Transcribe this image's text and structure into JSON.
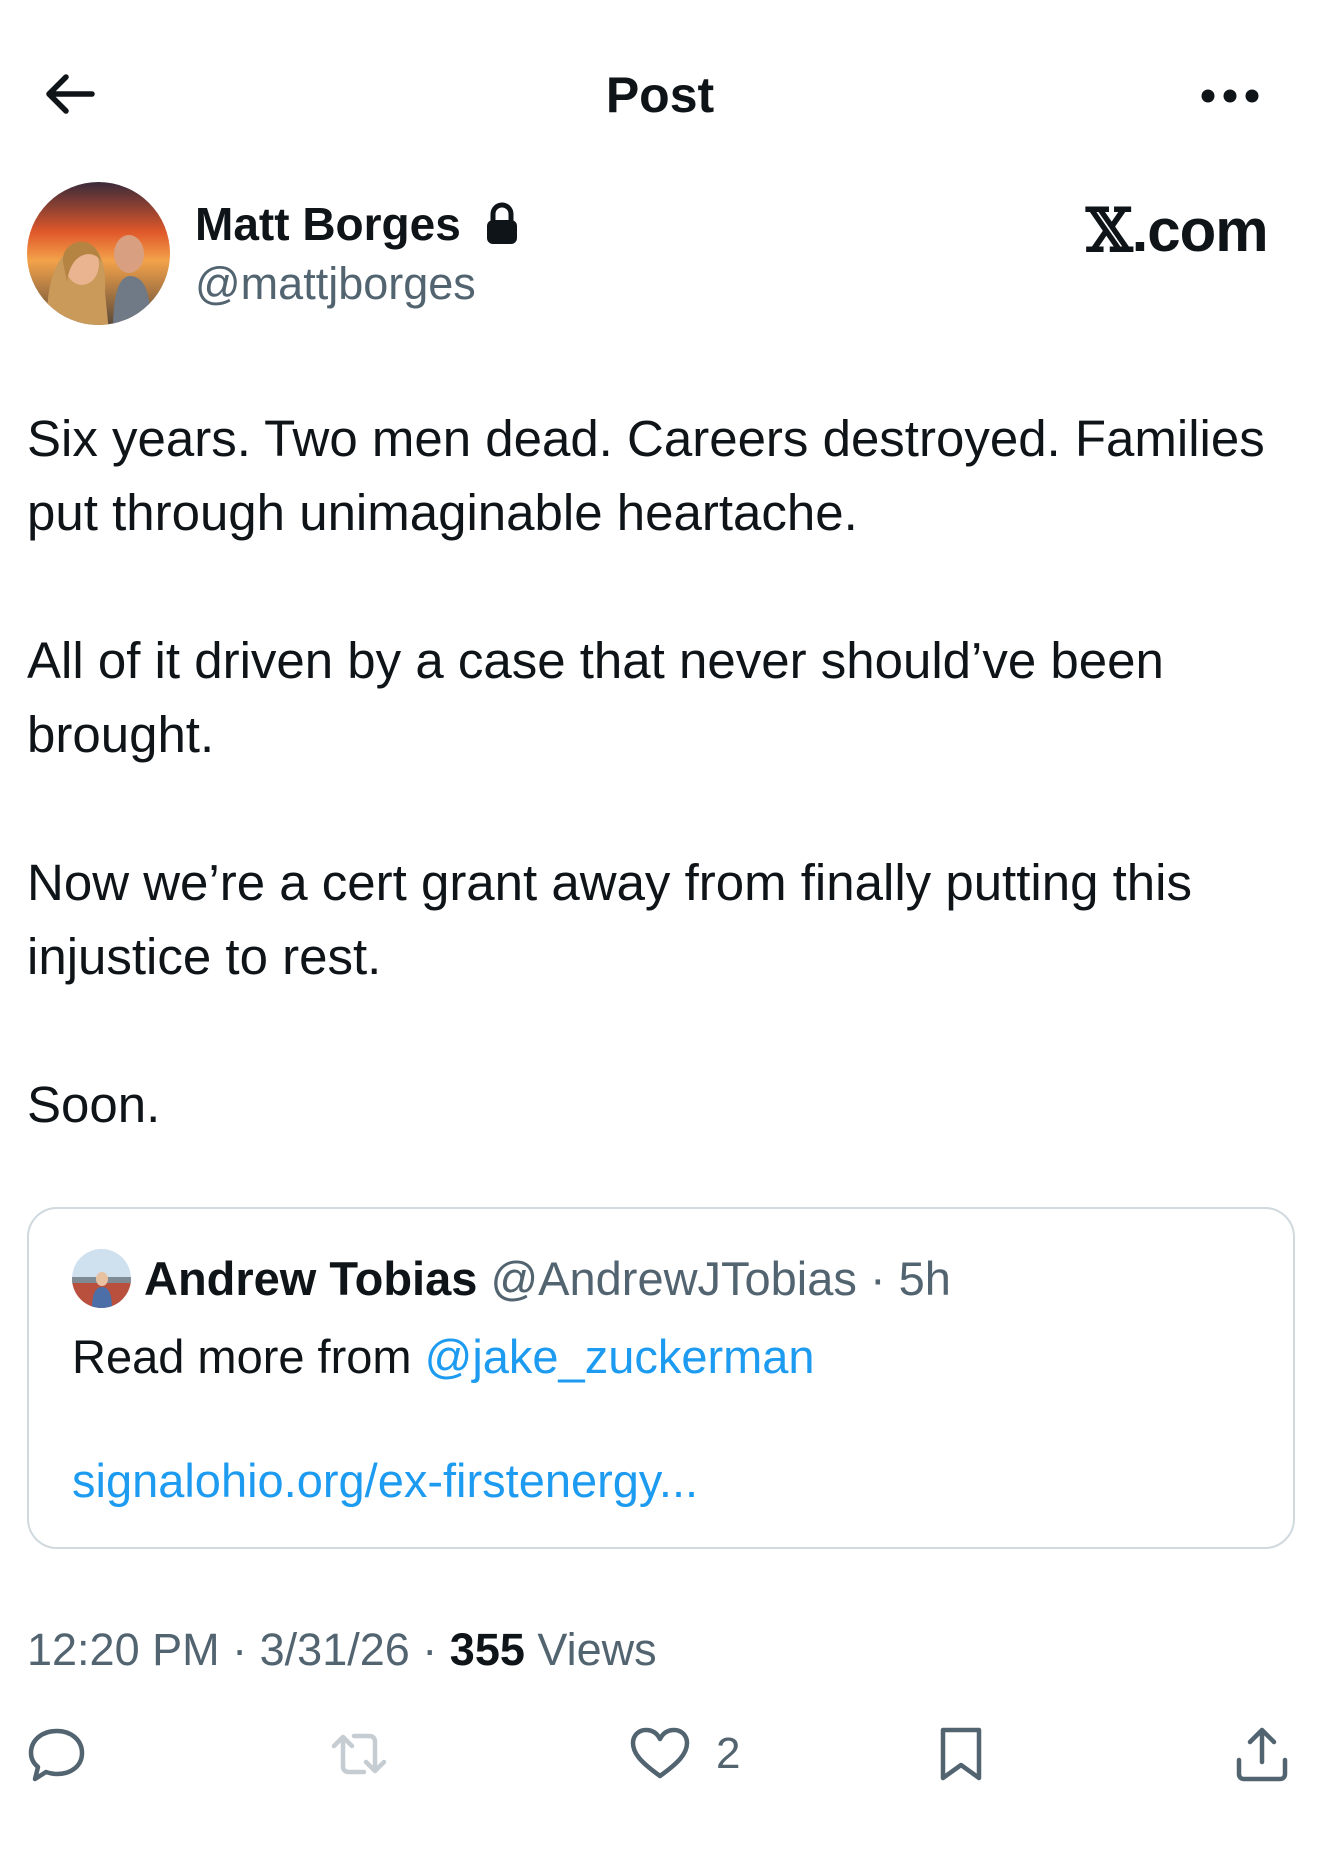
{
  "header": {
    "title": "Post"
  },
  "author": {
    "name": "Matt Borges",
    "handle": "@mattjborges",
    "protected": true
  },
  "brand": {
    "symbol": "𝕏",
    "domain": ".com"
  },
  "post": {
    "paragraphs": [
      "Six years. Two men dead. Careers destroyed. Families put through unimaginable heartache.",
      "All of it driven by a case that never should’ve been brought.",
      "Now we’re a cert grant away from finally putting this injustice to rest.",
      "Soon."
    ]
  },
  "quote": {
    "name": "Andrew Tobias",
    "handle": "@AndrewJTobias",
    "separator": "·",
    "time": "5h",
    "text_prefix": "Read more from ",
    "mention": "@jake_zuckerman",
    "link": "signalohio.org/ex-firstenergy..."
  },
  "meta": {
    "time": "12:20 PM",
    "separator": "·",
    "date": "3/31/26",
    "views_count": "355",
    "views_label": "Views"
  },
  "actions": {
    "likes": "2"
  },
  "colors": {
    "accent": "#1d9bf0",
    "secondary_text": "#536471",
    "border": "#cfd9de",
    "primary_text": "#0f1419"
  },
  "icons": [
    "back-arrow-icon",
    "more-icon",
    "lock-icon",
    "reply-icon",
    "repost-icon",
    "heart-icon",
    "bookmark-icon",
    "share-icon"
  ]
}
